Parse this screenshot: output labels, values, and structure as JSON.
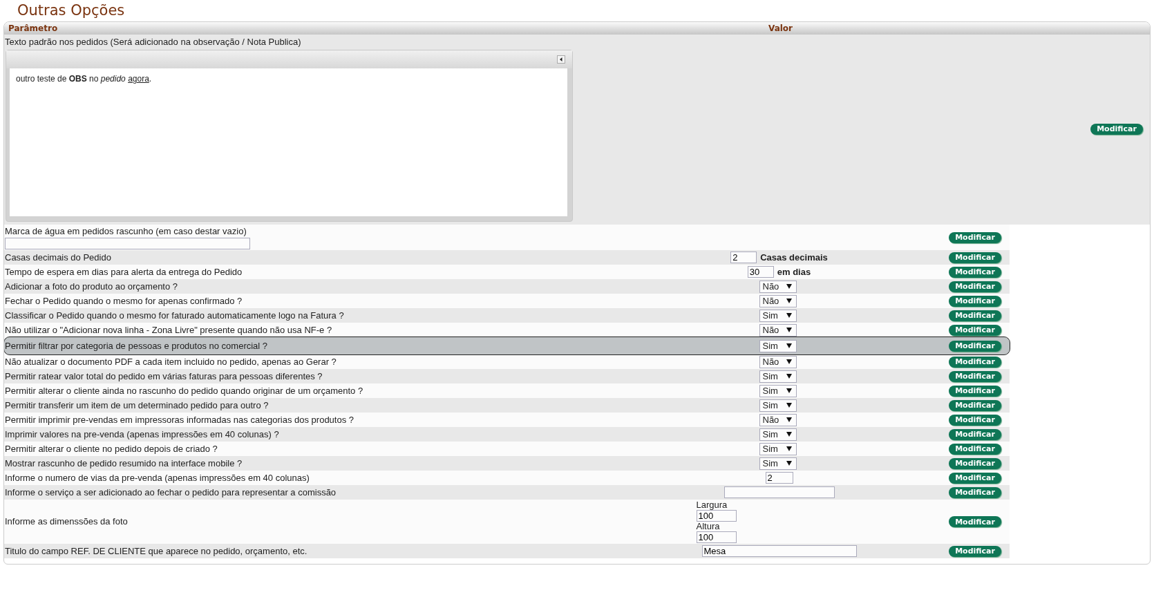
{
  "page_title": "Outras Opções",
  "columns": [
    "Parâmetro",
    "Valor"
  ],
  "editor_row": {
    "label": "Texto padrão nos pedidos (Será adicionado na observação / Nota Publica)",
    "button": "Modificar",
    "content": [
      {
        "kind": "plain",
        "text": "outro teste de "
      },
      {
        "kind": "bold",
        "text": "OBS"
      },
      {
        "kind": "plain",
        "text": " no "
      },
      {
        "kind": "italic",
        "text": "pedido "
      },
      {
        "kind": "underline",
        "text": "agora"
      },
      {
        "kind": "plain",
        "text": "."
      }
    ]
  },
  "rows": [
    {
      "kind": "text-field",
      "label": "Marca de água em pedidos rascunho (em caso destar vazio)",
      "button": "Modificar",
      "selected": false
    },
    {
      "kind": "number",
      "label": "Casas decimais do Pedido",
      "value": "2",
      "unit": "Casas decimais",
      "button": "Modificar",
      "selected": false
    },
    {
      "kind": "number",
      "label": "Tempo de espera em dias para alerta da entrega do Pedido",
      "value": "30",
      "unit": "em dias",
      "button": "Modificar",
      "selected": false
    },
    {
      "kind": "select",
      "label": "Adicionar a foto do produto ao orçamento ?",
      "value": "Não",
      "button": "Modificar",
      "selected": false
    },
    {
      "kind": "select",
      "label": "Fechar o Pedido quando o mesmo for apenas confirmado ?",
      "value": "Não",
      "button": "Modificar",
      "selected": false
    },
    {
      "kind": "select",
      "label": "Classificar o Pedido quando o mesmo for faturado automaticamente logo na Fatura ?",
      "value": "Sim",
      "button": "Modificar",
      "selected": false
    },
    {
      "kind": "select",
      "label": "Não utilizar o \"Adicionar nova linha - Zona Livre\" presente quando não usa NF-e ?",
      "value": "Não",
      "button": "Modificar",
      "selected": false
    },
    {
      "kind": "select",
      "label": "Permitir filtrar por categoria de pessoas e produtos no comercial ?",
      "value": "Sim",
      "button": "Modificar",
      "selected": true
    },
    {
      "kind": "select",
      "label": "Não atualizar o documento PDF a cada item incluido no pedido, apenas ao Gerar ?",
      "value": "Não",
      "button": "Modificar",
      "selected": false
    },
    {
      "kind": "select",
      "label": "Permitir ratear valor total do pedido em várias faturas para pessoas diferentes ?",
      "value": "Sim",
      "button": "Modificar",
      "selected": false
    },
    {
      "kind": "select",
      "label": "Permitir alterar o cliente ainda no rascunho do pedido quando originar de um orçamento ?",
      "value": "Sim",
      "button": "Modificar",
      "selected": false
    },
    {
      "kind": "select",
      "label": "Permitir transferir um item de um determinado pedido para outro ?",
      "value": "Sim",
      "button": "Modificar",
      "selected": false
    },
    {
      "kind": "select",
      "label": "Permitir imprimir pre-vendas em impressoras informadas nas categorias dos produtos ?",
      "value": "Não",
      "button": "Modificar",
      "selected": false
    },
    {
      "kind": "select",
      "label": "Imprimir valores na pre-venda (apenas impressões em 40 colunas) ?",
      "value": "Sim",
      "button": "Modificar",
      "selected": false
    },
    {
      "kind": "select",
      "label": "Permitir alterar o cliente no pedido depois de criado ?",
      "value": "Sim",
      "button": "Modificar",
      "selected": false
    },
    {
      "kind": "select",
      "label": "Mostrar rascunho de pedido resumido na interface mobile ?",
      "value": "Sim",
      "button": "Modificar",
      "selected": false
    },
    {
      "kind": "short-field",
      "label": "Informe o numero de vias da pre-venda (apenas impressões em 40 colunas)",
      "value": "2",
      "button": "Modificar",
      "selected": false
    },
    {
      "kind": "field",
      "label": "Informe o serviço a ser adicionado ao fechar o pedido para representar a comissão",
      "button": "Modificar",
      "selected": false
    },
    {
      "kind": "dimensions",
      "label": "Informe as dimenssões da foto",
      "fields": [
        {
          "label": "Largura",
          "value": "100"
        },
        {
          "label": "Altura",
          "value": "100"
        }
      ],
      "button": "Modificar",
      "selected": false
    },
    {
      "kind": "wide-field",
      "label": "Titulo do campo REF. DE CLIENTE que aparece no pedido, orçamento, etc.",
      "value": "Mesa",
      "button": "Modificar",
      "selected": false
    }
  ]
}
